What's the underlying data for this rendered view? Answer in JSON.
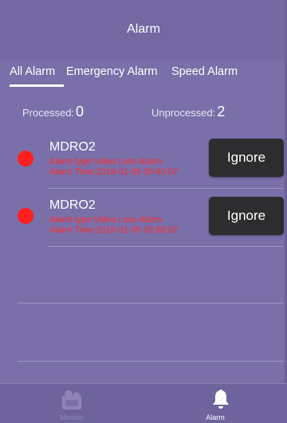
{
  "header": {
    "title": "Alarm"
  },
  "tabs": [
    {
      "label": "All Alarm",
      "active": true
    },
    {
      "label": "Emergency Alarm",
      "active": false
    },
    {
      "label": "Speed Alarm",
      "active": false
    }
  ],
  "counts": {
    "processed_label": "Processed:",
    "processed_value": "0",
    "unprocessed_label": "Unprocessed:",
    "unprocessed_value": "2"
  },
  "alarms": [
    {
      "device": "MDRO2",
      "type": "Alarm type:Video Loss Alarm",
      "time": "Alarm Time:2016-01-05 05:40:07",
      "button": "Ignore"
    },
    {
      "device": "MDRO2",
      "type": "Alarm type:Video Loss Alarm",
      "time": "Alarm Time:2016-01-05 03:58:02",
      "button": "Ignore"
    }
  ],
  "tabbar": {
    "monitor_label": "Monitor",
    "alarm_label": "Alarm",
    "monitor_icon": "monitor-icon",
    "alarm_icon": "bell-icon"
  },
  "colors": {
    "background": "#7a6fa8",
    "header": "#7468a3",
    "status_dot": "#ff1f1f",
    "alarm_text": "#ff2a2a",
    "button": "#2d2d30"
  }
}
